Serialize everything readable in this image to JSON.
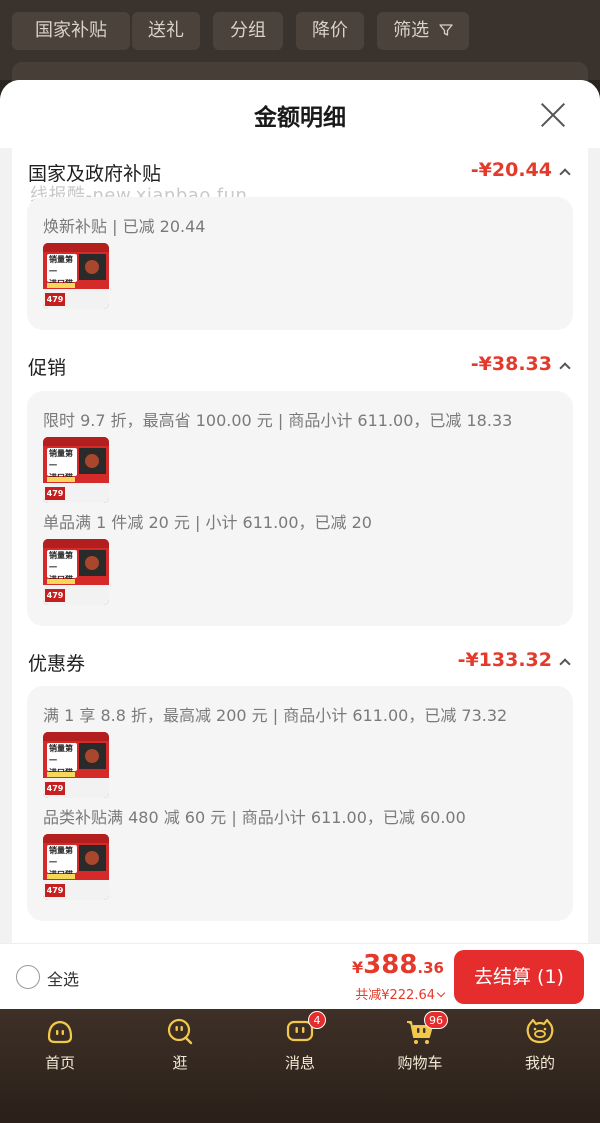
{
  "filter_bar": {
    "chips": [
      "国家补贴",
      "送礼",
      "分组",
      "降价",
      "筛选"
    ]
  },
  "sheet": {
    "title": "金额明细",
    "watermark": "线报酷-new.xianbao.fun",
    "sections": [
      {
        "title": "国家及政府补贴",
        "amount": "-¥20.44",
        "lines": [
          "焕新补贴 | 已减 20.44"
        ]
      },
      {
        "title": "促销",
        "amount": "-¥38.33",
        "lines": [
          "限时 9.7 折，最高省 100.00 元 | 商品小计 611.00，已减 18.33",
          "单品满 1 件减 20 元 | 小计 611.00，已减 20"
        ]
      },
      {
        "title": "优惠券",
        "amount": "-¥133.32",
        "lines": [
          "满 1 享 8.8 折，最高减 200 元 | 商品小计 611.00，已减 73.32",
          "品类补贴满 480 减 60 元 | 商品小计 611.00，已减 60.00"
        ]
      }
    ],
    "product_thumb": {
      "headline_1": "销量第一",
      "headline_2": "进口猫粮",
      "price": "479"
    }
  },
  "action_bar": {
    "select_all": "全选",
    "currency": "¥",
    "total_int": "388",
    "total_dec": ".36",
    "saved": "共减¥222.64",
    "checkout": "去结算 (1)"
  },
  "tabs": [
    {
      "label": "首页",
      "icon": "home-face-icon"
    },
    {
      "label": "逛",
      "icon": "browse-face-icon"
    },
    {
      "label": "消息",
      "icon": "message-icon",
      "badge": "4"
    },
    {
      "label": "购物车",
      "icon": "cart-icon",
      "badge": "96"
    },
    {
      "label": "我的",
      "icon": "profile-pig-icon"
    }
  ]
}
